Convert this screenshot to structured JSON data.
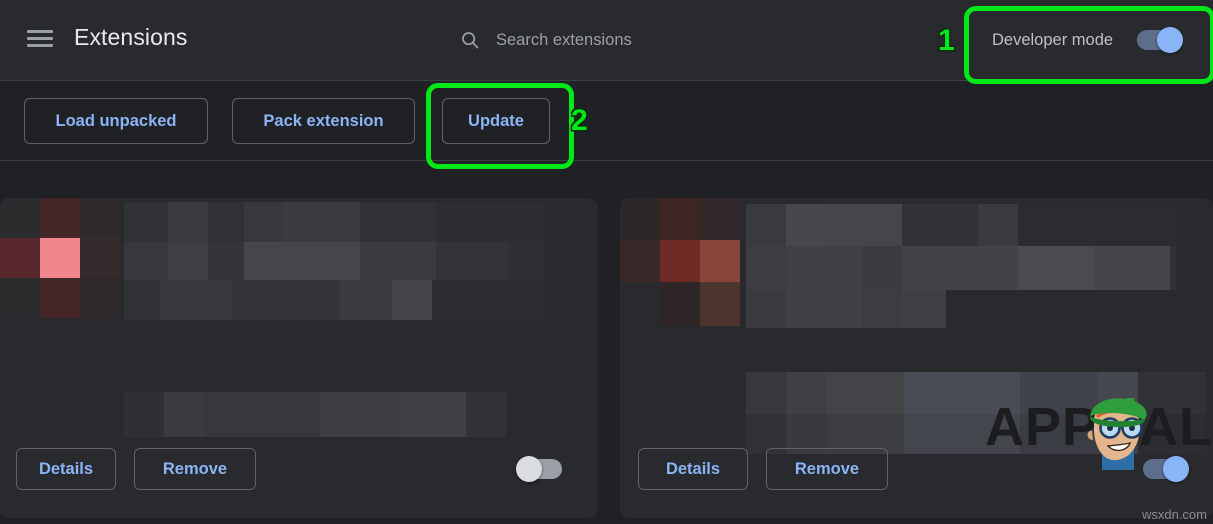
{
  "header": {
    "menu_icon": "hamburger-menu-icon",
    "title": "Extensions",
    "search": {
      "icon": "search-icon",
      "placeholder": "Search extensions",
      "value": ""
    },
    "developer_mode": {
      "label": "Developer mode",
      "state": "on"
    }
  },
  "toolbar": {
    "load_unpacked_label": "Load unpacked",
    "pack_extension_label": "Pack extension",
    "update_label": "Update"
  },
  "annotations": [
    {
      "number": "1",
      "target": "developer-mode-toggle",
      "color": "#00e818"
    },
    {
      "number": "2",
      "target": "update-button",
      "color": "#00e818"
    }
  ],
  "cards": [
    {
      "name_redacted": true,
      "description_redacted": true,
      "details_label": "Details",
      "remove_label": "Remove",
      "enabled": false
    },
    {
      "name_redacted": true,
      "description_redacted": true,
      "details_label": "Details",
      "remove_label": "Remove",
      "enabled": true
    }
  ],
  "watermark": {
    "brand": "APPUALS",
    "site": "wsxdn.com"
  },
  "colors": {
    "background": "#202124",
    "surface": "#292a2d",
    "accent_blue": "#8ab4f8",
    "toggle_on_track": "#5d6e8d",
    "toggle_off_track": "#9aa0a6",
    "text_primary": "#e8eaed",
    "text_secondary": "#bdc1c6",
    "border": "#5f6368",
    "highlight_green": "#00e818"
  }
}
